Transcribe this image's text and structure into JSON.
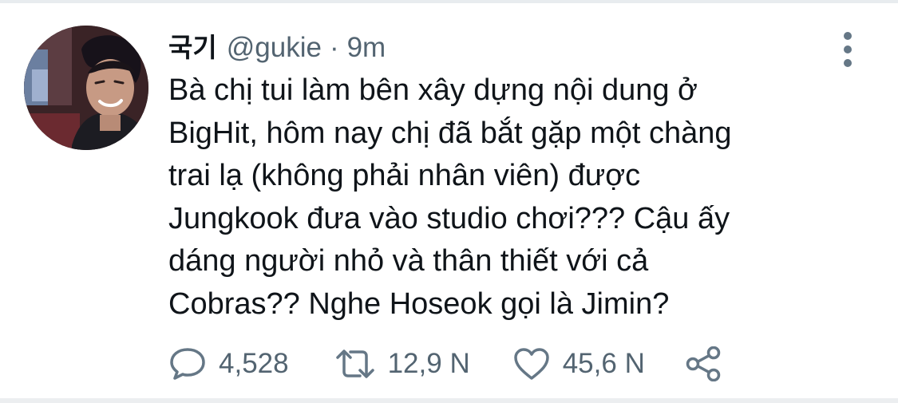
{
  "tweet": {
    "display_name": "국기",
    "handle": "@gukie",
    "separator": "·",
    "time": "9m",
    "text_lines": [
      "Bà chị tui làm bên xây dựng nội dung ở",
      "BigHit, hôm nay chị đã bắt gặp một chàng",
      "trai lạ (không phải nhân viên) được",
      "Jungkook đưa vào studio chơi??? Cậu ấy",
      "dáng người nhỏ và thân thiết với cả",
      "Cobras?? Nghe Hoseok gọi là Jimin?"
    ],
    "actions": {
      "reply_count": "4,528",
      "retweet_count": "12,9 N",
      "like_count": "45,6 N"
    }
  },
  "icons": {
    "avatar": "profile-photo",
    "more": "vertical-ellipsis-icon",
    "reply": "speech-bubble-icon",
    "retweet": "retweet-arrows-icon",
    "like": "heart-outline-icon",
    "share": "share-nodes-icon"
  },
  "colors": {
    "text": "#0f1419",
    "secondary": "#536471",
    "icon": "#657786",
    "divider": "#e8ecef"
  }
}
